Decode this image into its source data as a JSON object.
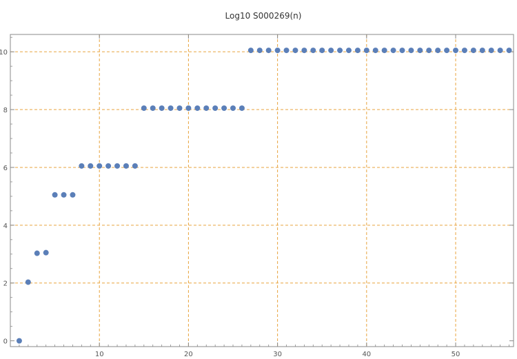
{
  "chart_data": {
    "type": "scatter",
    "title": "Log10 S000269(n)",
    "xlabel": "",
    "ylabel": "",
    "xlim": [
      0,
      56.5
    ],
    "ylim": [
      -0.2,
      10.6
    ],
    "xticks": [
      "10",
      "20",
      "30",
      "40",
      "50"
    ],
    "yticks": [
      "0",
      "2",
      "4",
      "6",
      "8",
      "10"
    ],
    "grid": true,
    "colors": {
      "points": "#5b7fb8",
      "grid": "#e8a33d",
      "frame": "#888888"
    },
    "series": [
      {
        "x": [
          1,
          2,
          3,
          4,
          5,
          6,
          7,
          8,
          9,
          10,
          11,
          12,
          13,
          14,
          15,
          16,
          17,
          18,
          19,
          20,
          21,
          22,
          23,
          24,
          25,
          26,
          27,
          28,
          29,
          30,
          31,
          32,
          33,
          34,
          35,
          36,
          37,
          38,
          39,
          40,
          41,
          42,
          43,
          44,
          45,
          46,
          47,
          48,
          49,
          50,
          51,
          52,
          53,
          54,
          55,
          56
        ],
        "y": [
          0,
          2.03,
          3.03,
          3.05,
          5.05,
          5.05,
          5.05,
          6.05,
          6.05,
          6.05,
          6.05,
          6.05,
          6.05,
          6.05,
          8.05,
          8.05,
          8.05,
          8.05,
          8.05,
          8.05,
          8.05,
          8.05,
          8.05,
          8.05,
          8.05,
          8.05,
          10.05,
          10.05,
          10.05,
          10.05,
          10.05,
          10.05,
          10.05,
          10.05,
          10.05,
          10.05,
          10.05,
          10.05,
          10.05,
          10.05,
          10.05,
          10.05,
          10.05,
          10.05,
          10.05,
          10.05,
          10.05,
          10.05,
          10.05,
          10.05,
          10.05,
          10.05,
          10.05,
          10.05,
          10.05,
          10.05
        ]
      }
    ]
  }
}
